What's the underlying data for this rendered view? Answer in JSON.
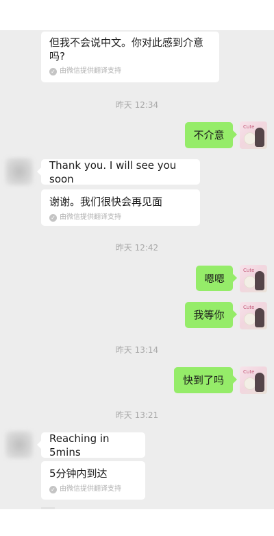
{
  "messages": {
    "m1": {
      "text_line1": "但我不会说中文。你对此感到介意",
      "text_line2": "吗?",
      "note": "由微信提供翻译支持"
    },
    "t1": "昨天 12:34",
    "m2": {
      "text": "不介意"
    },
    "m3": {
      "text": "Thank you. I will see you soon"
    },
    "m4": {
      "text": "谢谢。我们很快会再见面",
      "note": "由微信提供翻译支持"
    },
    "t2": "昨天 12:42",
    "m5": {
      "text": "嗯嗯"
    },
    "m6": {
      "text": "我等你"
    },
    "t3": "昨天 13:14",
    "m7": {
      "text": "快到了吗"
    },
    "t4": "昨天 13:21",
    "m8": {
      "text": "Reaching in 5mins"
    },
    "m9": {
      "text": "5分钟内到达",
      "note": "由微信提供翻译支持"
    }
  },
  "avatar_me": {
    "tag": "Cute"
  },
  "colors": {
    "background": "#ededed",
    "sent_bubble": "#95ec69",
    "received_bubble": "#ffffff",
    "timestamp": "#a8a8a8"
  },
  "icons": {
    "translate_check": "check-circle-icon"
  }
}
